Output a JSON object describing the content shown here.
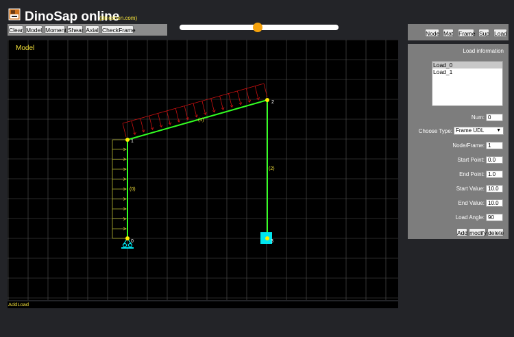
{
  "header": {
    "title": "DinoSap online",
    "subtitle": "(dinochen.com)"
  },
  "toolbar": {
    "clear": "Clear",
    "model": "Model",
    "moment": "Moment",
    "shear": "Shear",
    "axial": "Axial",
    "check_frame": "CheckFrame"
  },
  "slider": {
    "value_percent": 49
  },
  "nav": {
    "node": "Node",
    "mat": "Mat",
    "frame": "Frame",
    "sup": "Sup",
    "load": "Load"
  },
  "panel": {
    "heading": "Load information",
    "loads": [
      "Load_0",
      "Load_1"
    ],
    "selected_load": "Load_0",
    "num_label": "Num:",
    "num_value": "0",
    "type_label": "Choose Type:",
    "type_value": "Frame UDL",
    "nodeframe_label": "Node/Frame:",
    "nodeframe_value": "1",
    "start_point_label": "Start Point:",
    "start_point_value": "0.0",
    "end_point_label": "End Point:",
    "end_point_value": "1.0",
    "start_value_label": "Start Value:",
    "start_value_value": "10.0",
    "end_value_label": "End Value:",
    "end_value_value": "10.0",
    "load_angle_label": "Load Angle:",
    "load_angle_value": "90",
    "add": "Add",
    "modify": "modify",
    "delete": "delete"
  },
  "canvas": {
    "mode_label": "Model",
    "node_labels": [
      "0",
      "1",
      "2",
      "3"
    ],
    "frame_labels": [
      "(0)",
      "(1)",
      "(2)"
    ]
  },
  "status": "AddLoad",
  "colors": {
    "frame": "#33ff22",
    "node": "#ffee00",
    "grid": "#555555",
    "load_udl": "#cc1111",
    "load_lateral": "#bbbb33",
    "support": "#00e5ee",
    "accent": "#f5a20c"
  }
}
